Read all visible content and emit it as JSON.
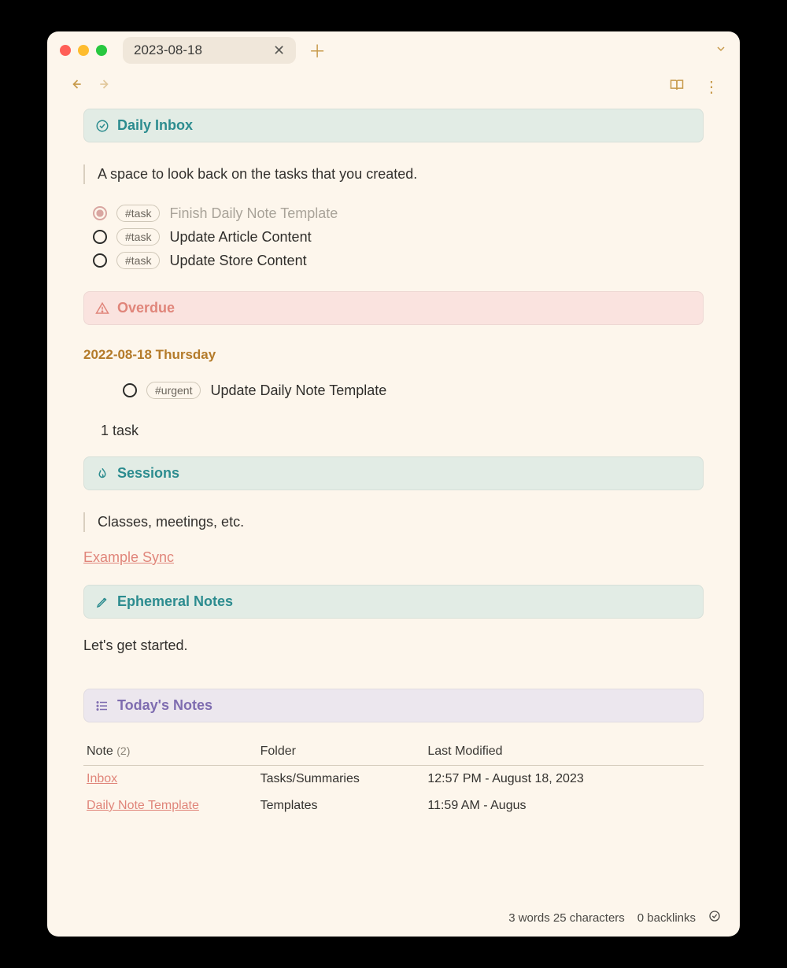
{
  "tab": {
    "title": "2023-08-18"
  },
  "sections": {
    "inbox": {
      "title": "Daily Inbox",
      "quote": "A space to look back on the tasks that you created.",
      "tasks": [
        {
          "tag": "#task",
          "text": "Finish Daily Note Template",
          "done": true
        },
        {
          "tag": "#task",
          "text": "Update Article Content",
          "done": false
        },
        {
          "tag": "#task",
          "text": "Update Store Content",
          "done": false
        }
      ]
    },
    "overdue": {
      "title": "Overdue",
      "date": "2022-08-18 Thursday",
      "tasks": [
        {
          "tag": "#urgent",
          "text": "Update Daily Note Template",
          "done": false
        }
      ],
      "summary": "1 task"
    },
    "sessions": {
      "title": "Sessions",
      "quote": "Classes, meetings, etc.",
      "link": "Example Sync"
    },
    "ephemeral": {
      "title": "Ephemeral Notes",
      "text": "Let's get started."
    },
    "today": {
      "title": "Today's Notes",
      "columns": [
        "Note",
        "Folder",
        "Last Modified"
      ],
      "count": "(2)",
      "rows": [
        {
          "note": "Inbox",
          "folder": "Tasks/Summaries",
          "modified": "12:57 PM - August 18, 2023"
        },
        {
          "note": "Daily Note Template",
          "folder": "Templates",
          "modified": "11:59 AM - Augus"
        }
      ]
    }
  },
  "status": {
    "words": "3 words 25 characters",
    "backlinks": "0 backlinks"
  }
}
